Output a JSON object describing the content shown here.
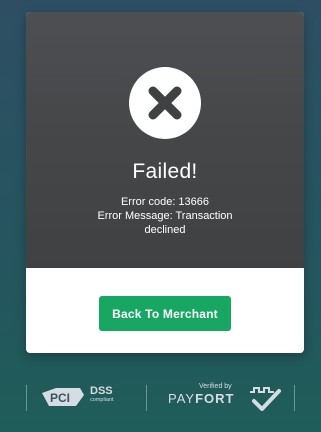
{
  "status": {
    "title": "Failed!",
    "error_code_line": "Error code: 13666",
    "error_message_line_1": "Error Message: Transaction",
    "error_message_line_2": "declined",
    "icon": "close-icon"
  },
  "actions": {
    "back_label": "Back To Merchant",
    "button_color": "#17A763"
  },
  "footer": {
    "pci_logo": "pci-logo",
    "pci_logo_text": "PCI",
    "dss_label": "DSS",
    "dss_sub": "compliant",
    "verified_by": "Verified by",
    "payfort_pay": "PAY",
    "payfort_fort": "FORT"
  },
  "colors": {
    "card_dark": "#454749",
    "background": "#2A5860",
    "white": "#FFFFFF",
    "footer_text": "#D6DDE2"
  }
}
